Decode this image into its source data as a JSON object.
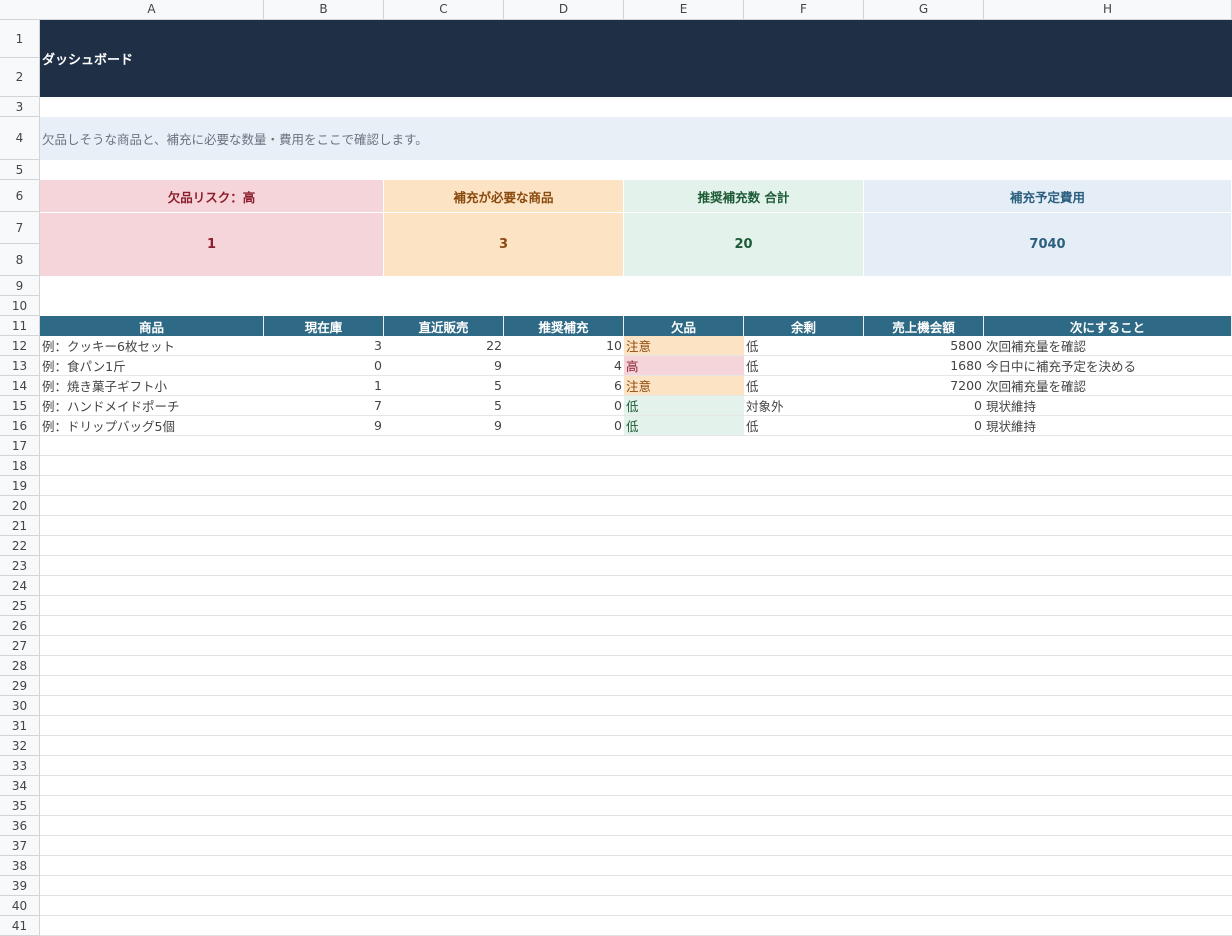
{
  "sheet": {
    "columns": [
      "A",
      "B",
      "C",
      "D",
      "E",
      "F",
      "G",
      "H"
    ],
    "row_numbers": [
      "1",
      "2",
      "3",
      "4",
      "5",
      "6",
      "7",
      "8",
      "9",
      "10",
      "11",
      "12",
      "13",
      "14",
      "15",
      "16",
      "17",
      "18",
      "19",
      "20",
      "21",
      "22",
      "23",
      "24",
      "25",
      "26",
      "27",
      "28",
      "29",
      "30",
      "31",
      "32",
      "33",
      "34",
      "35",
      "36",
      "37",
      "38",
      "39",
      "40",
      "41"
    ]
  },
  "dashboard": {
    "title": "ダッシュボード",
    "description": "欠品しそうな商品と、補充に必要な数量・費用をここで確認します。"
  },
  "cards": [
    {
      "label": "欠品リスク：高",
      "value": "1",
      "color": "#8b1e2d",
      "bg": "#f6d5da"
    },
    {
      "label": "補充が必要な商品",
      "value": "3",
      "color": "#8a4a0f",
      "bg": "#fce3c4"
    },
    {
      "label": "推奨補充数 合計",
      "value": "20",
      "color": "#1d5b36",
      "bg": "#e3f2ea"
    },
    {
      "label": "補充予定費用",
      "value": "7040",
      "color": "#2b5f7f",
      "bg": "#e5eef6"
    }
  ],
  "table": {
    "headers": [
      "商品",
      "現在庫",
      "直近販売",
      "推奨補充",
      "欠品",
      "余剰",
      "売上機会額",
      "次にすること"
    ],
    "rows": [
      [
        "例：クッキー6枚セット",
        "3",
        "22",
        "10",
        "注意",
        "低",
        "5800",
        "次回補充量を確認"
      ],
      [
        "例：食パン1斤",
        "0",
        "9",
        "4",
        "高",
        "低",
        "1680",
        "今日中に補充予定を決める"
      ],
      [
        "例：焼き菓子ギフト小",
        "1",
        "5",
        "6",
        "注意",
        "低",
        "7200",
        "次回補充量を確認"
      ],
      [
        "例：ハンドメイドポーチ",
        "7",
        "5",
        "0",
        "低",
        "対象外",
        "0",
        "現状維持"
      ],
      [
        "例：ドリップバッグ5個",
        "9",
        "9",
        "0",
        "低",
        "低",
        "0",
        "現状維持"
      ]
    ],
    "status_colors": {
      "注意": {
        "bg": "#fce3c4",
        "fg": "#8a4a0f"
      },
      "高": {
        "bg": "#f6d5da",
        "fg": "#8b1e2d"
      },
      "低": {
        "bg": "#e3f2ea",
        "fg": "#1d5b36"
      }
    }
  }
}
